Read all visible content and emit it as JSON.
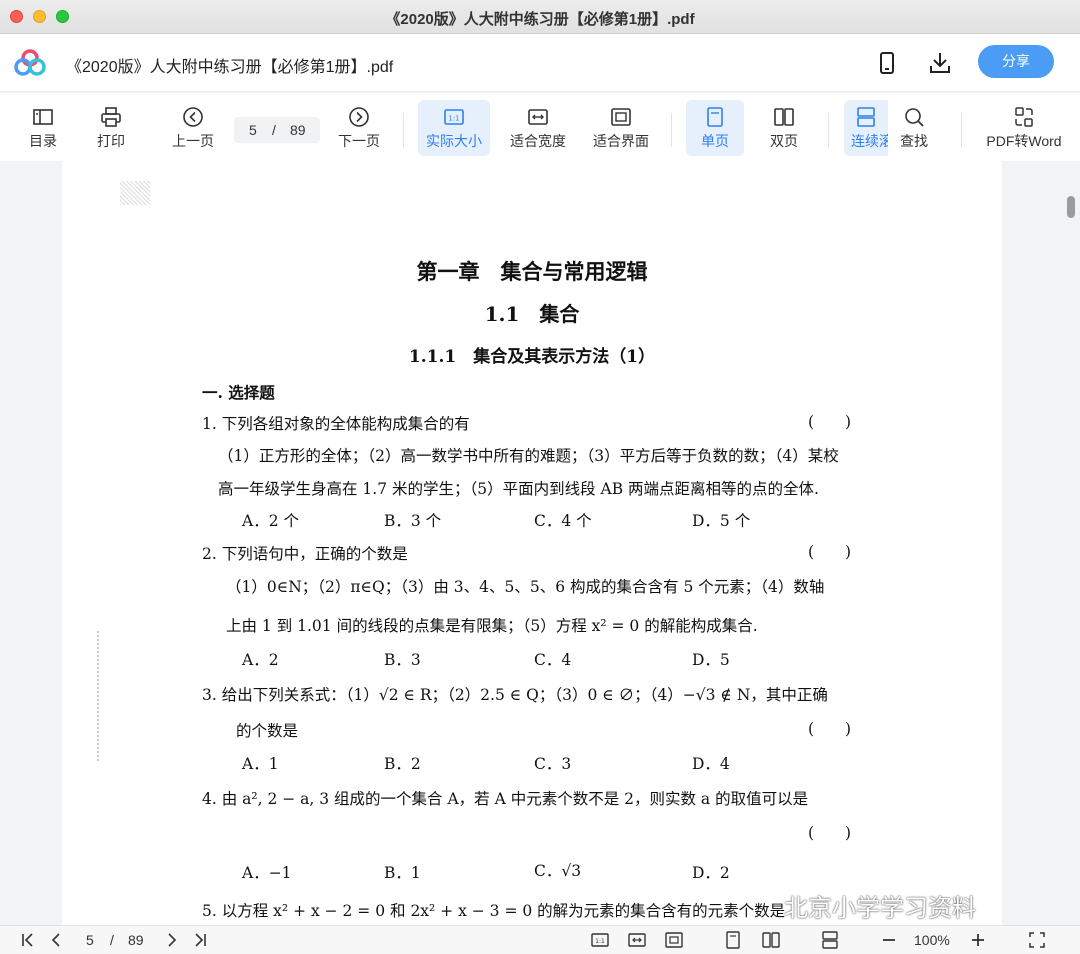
{
  "window": {
    "title": "《2020版》人大附中练习册【必修第1册】.pdf"
  },
  "header": {
    "file_title": "《2020版》人大附中练习册【必修第1册】.pdf",
    "share_label": "分享",
    "icons": [
      "phone-icon",
      "download-icon"
    ]
  },
  "toolbar": {
    "toc": "目录",
    "print": "打印",
    "prev": "上一页",
    "page_current": "5",
    "page_sep": "/",
    "page_total": "89",
    "next": "下一页",
    "actual_size": "实际大小",
    "fit_width": "适合宽度",
    "fit_page": "适合界面",
    "single": "单页",
    "double": "双页",
    "continuous": "连续滚",
    "find": "查找",
    "pdf_to_word": "PDF转Word"
  },
  "document": {
    "chapter": "第一章　集合与常用逻辑",
    "section": "1.1　集合",
    "subsection": "1.1.1　集合及其表示方法（1）",
    "part": "一. 选择题",
    "q1": {
      "stem": "1.  下列各组对象的全体能构成集合的有",
      "paren": "(　　)",
      "line1": "（1）正方形的全体；（2）高一数学书中所有的难题；（3）平方后等于负数的数；（4）某校",
      "line2": "高一年级学生身高在 1.7 米的学生；（5）平面内到线段 AB 两端点距离相等的点的全体.",
      "options": [
        "A．2 个",
        "B．3 个",
        "C．4 个",
        "D．5 个"
      ]
    },
    "q2": {
      "stem": "2.  下列语句中，正确的个数是",
      "paren": "(　　)",
      "line1": "（1）0∈N；（2）π∈Q；（3）由 3、4、5、5、6 构成的集合含有 5 个元素；（4）数轴",
      "line2": "上由 1 到 1.01 间的线段的点集是有限集；（5）方程 x² = 0 的解能构成集合.",
      "options": [
        "A．2",
        "B．3",
        "C．4",
        "D．5"
      ]
    },
    "q3": {
      "stem": "3.  给出下列关系式：（1）√2 ∈ R；（2）2.5 ∈ Q；（3）0 ∈ ∅；（4）−√3 ∉ N，其中正确",
      "line2": "的个数是",
      "paren": "(　　)",
      "options": [
        "A．1",
        "B．2",
        "C．3",
        "D．4"
      ]
    },
    "q4": {
      "stem": "4.  由 a², 2 − a, 3 组成的一个集合 A，若 A 中元素个数不是 2，则实数 a 的取值可以是",
      "paren": "(　　)",
      "options": [
        "A．−1",
        "B．1",
        "C．√3",
        "D．2"
      ]
    },
    "q5": {
      "stem": "5.  以方程 x² + x − 2 = 0 和 2x² + x − 3 = 0 的解为元素的集合含有的元素个数是"
    }
  },
  "watermark": "北京小学学习资料",
  "bottombar": {
    "page_current": "5",
    "page_sep": "/",
    "page_total": "89",
    "zoom": "100%"
  }
}
